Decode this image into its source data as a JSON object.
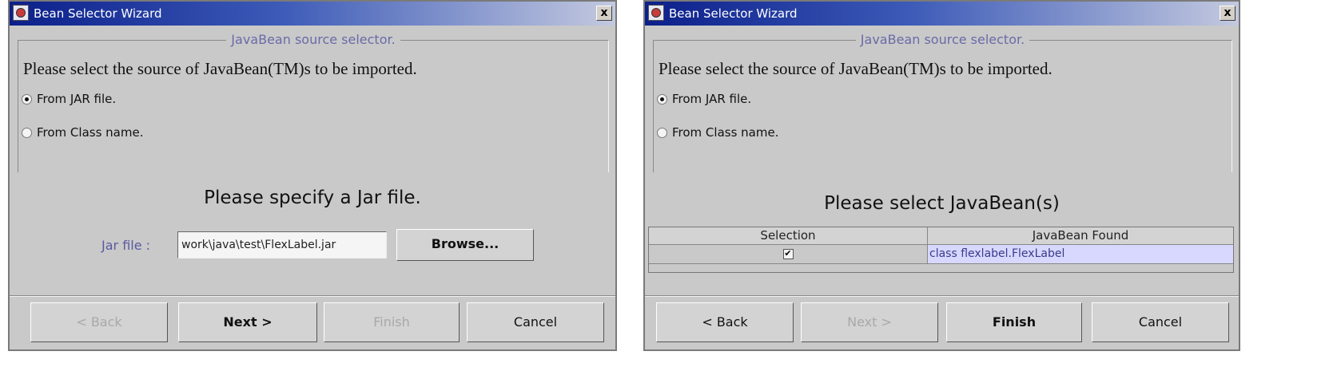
{
  "window_left": {
    "title": "Bean Selector Wizard",
    "close_label": "x",
    "group_title": "JavaBean source selector.",
    "prompt": "Please select the source of JavaBean(TM)s to be imported.",
    "radio_jar": "From JAR file.",
    "radio_class": "From Class name.",
    "selected_source": "jar",
    "heading": "Please specify a Jar file.",
    "jar_label": "Jar file :",
    "jar_value": "work\\java\\test\\FlexLabel.jar",
    "browse_label": "Browse...",
    "buttons": {
      "back": "< Back",
      "next": "Next >",
      "finish": "Finish",
      "cancel": "Cancel"
    },
    "enabled": {
      "back": false,
      "next": true,
      "finish": false,
      "cancel": true
    }
  },
  "window_right": {
    "title": "Bean Selector Wizard",
    "close_label": "x",
    "group_title": "JavaBean source selector.",
    "prompt": "Please select the source of JavaBean(TM)s to be imported.",
    "radio_jar": "From JAR file.",
    "radio_class": "From Class name.",
    "selected_source": "jar",
    "heading": "Please select JavaBean(s)",
    "table": {
      "columns": [
        "Selection",
        "JavaBean Found"
      ],
      "rows": [
        {
          "selected": true,
          "bean": "class flexlabel.FlexLabel"
        }
      ]
    },
    "buttons": {
      "back": "< Back",
      "next": "Next >",
      "finish": "Finish",
      "cancel": "Cancel"
    },
    "enabled": {
      "back": true,
      "next": false,
      "finish": true,
      "cancel": true
    }
  },
  "colors": {
    "title_start": "#0b1f8a",
    "dialog_bg": "#c9c9c9",
    "label_blue": "#5a5aa0",
    "selected_row": "#d8d8ff"
  }
}
